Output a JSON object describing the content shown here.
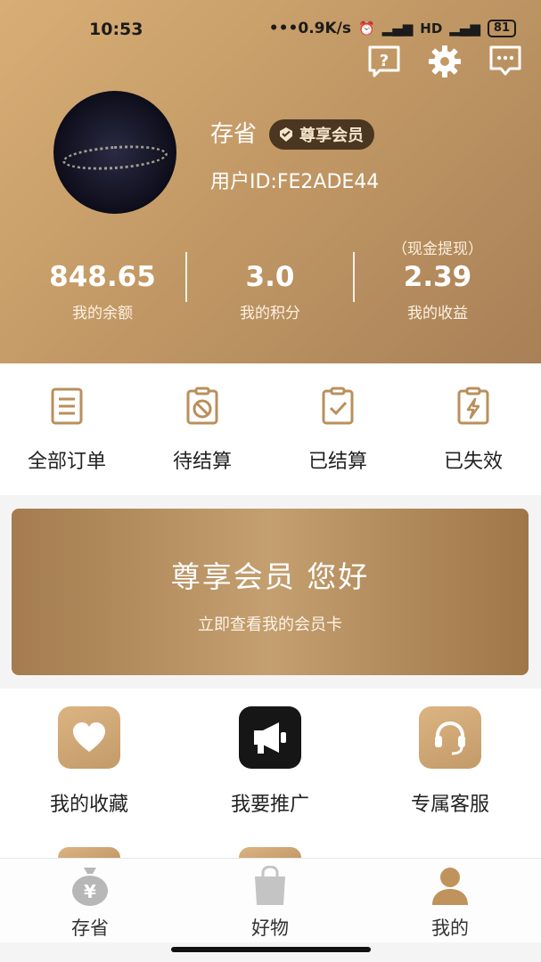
{
  "status_bar": {
    "time": "10:53",
    "net_speed": "0.9K/s",
    "battery": "81"
  },
  "profile": {
    "name": "存省",
    "vip_label": "尊享会员",
    "user_id": "用户ID:FE2ADE44"
  },
  "stats": [
    {
      "value": "848.65",
      "label": "我的余额",
      "sub": ""
    },
    {
      "value": "3.0",
      "label": "我的积分",
      "sub": ""
    },
    {
      "value": "2.39",
      "label": "我的收益",
      "sub": "（现金提现）"
    }
  ],
  "orders": [
    {
      "label": "全部订单",
      "icon": "document-list-icon"
    },
    {
      "label": "待结算",
      "icon": "clipboard-block-icon"
    },
    {
      "label": "已结算",
      "icon": "clipboard-check-icon"
    },
    {
      "label": "已失效",
      "icon": "clipboard-bolt-icon"
    }
  ],
  "vip_banner": {
    "title": "尊享会员 您好",
    "subtitle": "立即查看我的会员卡"
  },
  "services": [
    {
      "label": "我的收藏",
      "icon": "heart-icon"
    },
    {
      "label": "我要推广",
      "icon": "megaphone-icon"
    },
    {
      "label": "专属客服",
      "icon": "headset-icon"
    }
  ],
  "bottom_nav": [
    {
      "label": "存省",
      "icon": "money-bag-icon"
    },
    {
      "label": "好物",
      "icon": "shopping-bag-icon"
    },
    {
      "label": "我的",
      "icon": "user-icon"
    }
  ],
  "colors": {
    "header_gold": "#c39a66",
    "badge_dark": "#4a3621",
    "banner_gold": "#b08a5c"
  }
}
